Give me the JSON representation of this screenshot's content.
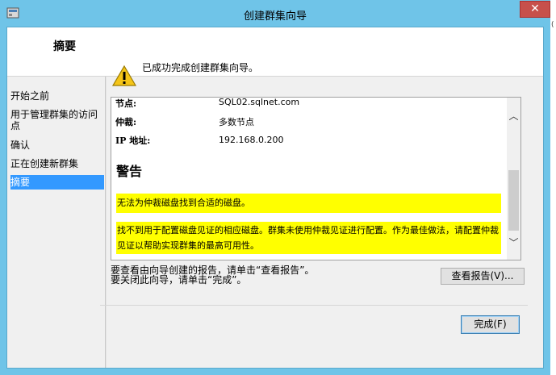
{
  "window": {
    "title": "创建群集向导",
    "close_glyph": "✕"
  },
  "header": {
    "title": "摘要"
  },
  "sidebar": {
    "items": [
      {
        "label": "开始之前"
      },
      {
        "label": "用于管理群集的访问点"
      },
      {
        "label": "确认"
      },
      {
        "label": "正在创建新群集"
      },
      {
        "label": "摘要"
      }
    ],
    "selected_index": 4
  },
  "main": {
    "status_message": "已成功完成创建群集向导。",
    "report": {
      "rows": [
        {
          "label": "节点:",
          "value": "SQL02.sqlnet.com"
        },
        {
          "label": "仲裁:",
          "value": "多数节点"
        },
        {
          "label": "IP 地址:",
          "value": "192.168.0.200"
        }
      ],
      "warning_heading": "警告",
      "warnings": [
        "无法为仲裁磁盘找到合适的磁盘。",
        "找不到用于配置磁盘见证的相应磁盘。群集未使用仲裁见证进行配置。作为最佳做法，请配置仲裁见证以帮助实现群集的最高可用性。"
      ]
    },
    "hint_view": "要查看由向导创建的报告，请单击“查看报告”。",
    "hint_close": "要关闭此向导，请单击“完成”。",
    "view_report_button": "查看报告(V)...",
    "finish_button": "完成(F)"
  },
  "colors": {
    "title_bar": "#6fc4e8",
    "selected_item": "#3399ff",
    "warning_highlight": "#ffff00",
    "close_button": "#c7504b"
  },
  "icons": [
    "app-icon",
    "warning-icon",
    "scroll-up-icon",
    "scroll-down-icon"
  ],
  "gutter_text": "("
}
